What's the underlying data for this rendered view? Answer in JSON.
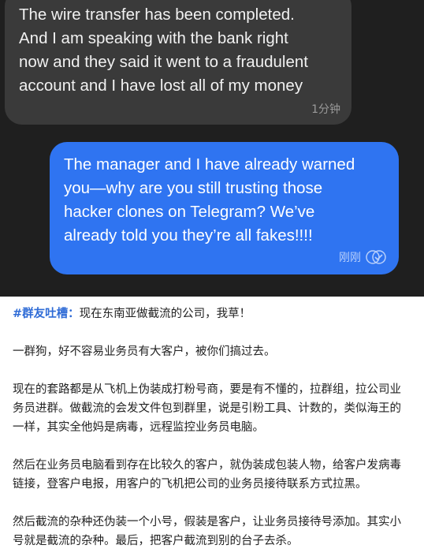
{
  "chat": {
    "incoming": {
      "lines": [
        "The wire transfer has been completed.",
        "And I am speaking with the bank right",
        "now and they said it went to a fraudulent",
        "account and I have lost all of my money"
      ],
      "time": "1分钟"
    },
    "outgoing": {
      "lines": [
        "The manager and I have already warned",
        "you—why are you still trusting those",
        "hacker clones on Telegram? We’ve",
        "already told you they’re all fakes!!!!"
      ],
      "time": "刚刚",
      "status_icon": "double-check-icon"
    }
  },
  "article": {
    "tag": "#群友吐槽",
    "colon": "：",
    "paragraphs": [
      "现在东南亚做截流的公司，我草！",
      "一群狗，好不容易业务员有大客户，被你们搞过去。",
      "现在的套路都是从飞机上伪装成打粉号商，要是有不懂的，拉群组，拉公司业务员进群。做截流的会发文件包到群里，说是引粉工具、计数的，类似海王的一样，其实全他妈是病毒，远程监控业务员电脑。",
      "然后在业务员电脑看到存在比较久的客户，就伪装成包装人物，给客户发病毒链接，登客户电报，用客户的飞机把公司的业务员接待联系方式拉黑。",
      "然后截流的杂种还伪装一个小号，假装是客户，让业务员接待号添加。其实小号就是截流的杂种。最后，把客户截流到别的台子去杀。"
    ]
  },
  "colors": {
    "chat_bg": "#1f1f1f",
    "incoming_bubble": "#3a3a3a",
    "outgoing_bubble": "#2f74f1",
    "tag": "#2e6bd6"
  }
}
